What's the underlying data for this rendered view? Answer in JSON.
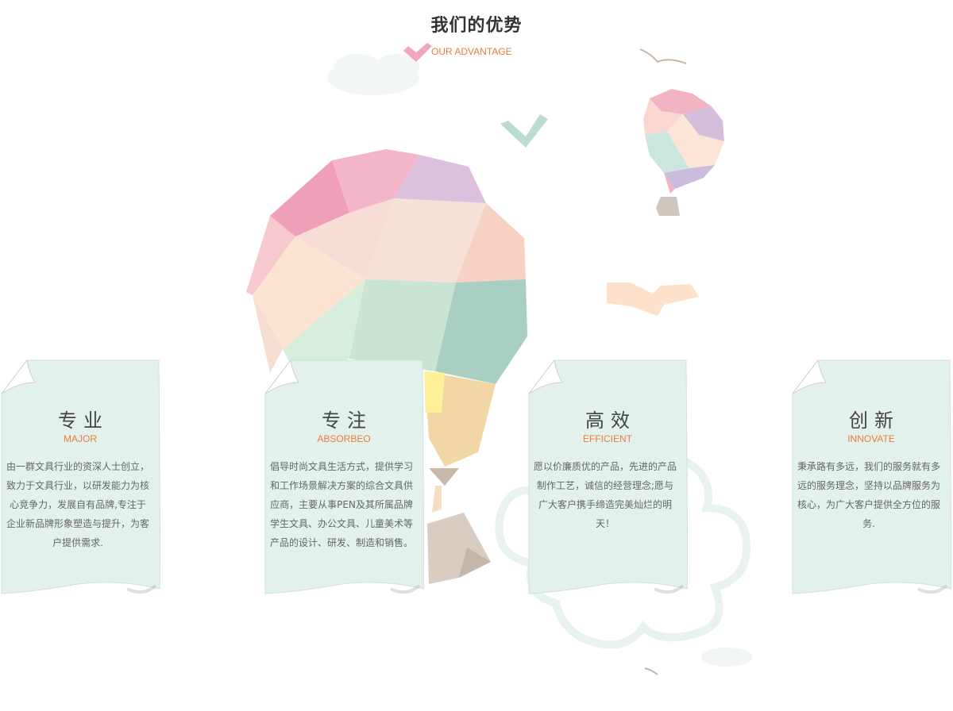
{
  "section": {
    "title": "我们的优势",
    "subtitle": "OUR ADVANTAGE"
  },
  "cards": [
    {
      "title": "专业",
      "subtitle": "MAJOR",
      "text": "由一群文具行业的资深人士创立，致力于文具行业，以研发能力为核心竞争力，发展自有品牌,专注于企业新品牌形象塑造与提升，为客户提供需求."
    },
    {
      "title": "专注",
      "subtitle": "ABSORBEO",
      "text": "倡导时尚文具生活方式，提供学习和工作场景解决方案的综合文具供应商，主要从事PEN及其所属品牌学生文具、办公文具、儿童美术等产品的设计、研发、制造和销售。"
    },
    {
      "title": "高效",
      "subtitle": "EFFICIENT",
      "text": "愿以价廉质优的产品，先进的产品制作工艺，诚信的经营理念;愿与广大客户携手缔造完美灿烂的明天！"
    },
    {
      "title": "创新",
      "subtitle": "INNOVATE",
      "text": "秉承路有多远，我们的服务就有多远的服务理念，坚持以品牌服务为核心，为广大客户提供全方位的服务."
    }
  ],
  "colors": {
    "accent": "#ee7a3e",
    "card_bg": "#e2f1ec",
    "title": "#333333",
    "text": "#666666"
  },
  "icons": [
    "hot-air-balloon-large",
    "hot-air-balloon-small",
    "bird",
    "cloud",
    "checkmark",
    "folded-corner"
  ]
}
